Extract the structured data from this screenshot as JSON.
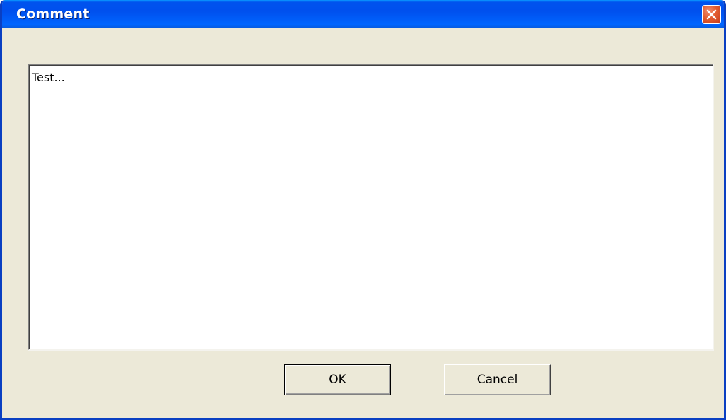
{
  "window": {
    "title": "Comment"
  },
  "comment": {
    "value": "Test..."
  },
  "buttons": {
    "ok_label": "OK",
    "cancel_label": "Cancel"
  },
  "icons": {
    "close": "close-icon"
  },
  "colors": {
    "titlebar": "#0053ee",
    "close_button": "#e25c2f",
    "dialog_background": "#ece9d8"
  }
}
